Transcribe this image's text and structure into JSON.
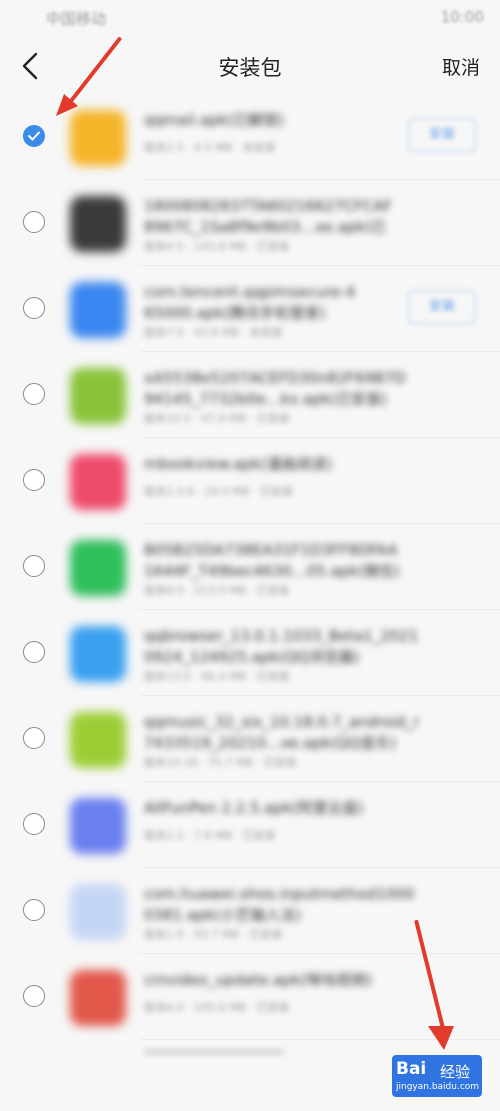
{
  "status_bar": {
    "carrier": "中国移动",
    "time": "10:00"
  },
  "header": {
    "title": "安装包",
    "cancel_label": "取消"
  },
  "items": [
    {
      "name": "qqmail.apk(已解锁)",
      "meta": "版本2.5 · 4.5 MB · 未安装",
      "icon_color": "#f5b52a",
      "checked": true,
      "tag": "安装",
      "single": true
    },
    {
      "name": "18008082837TA60216627CFCAF\n8967C_1Sa8f9e9b03…xe.apk(已",
      "meta": "版本4.5 · 143.8 MB · 已安装",
      "icon_color": "#3a3a3a",
      "checked": false,
      "tag": ""
    },
    {
      "name": "com.tencent.qqpimsecure-4\n65000.apk(腾讯手机管家)",
      "meta": "版本7.5 · 43.8 MB · 未安装",
      "icon_color": "#3a86f0",
      "checked": false,
      "tag": "安装"
    },
    {
      "name": "xA5538e5207ACEFD30n82F69B7D\n94145_7732b0e…kx.apk(已安装)",
      "meta": "版本10.5 · 47.9 MB · 已安装",
      "icon_color": "#8ac33a",
      "checked": false,
      "tag": ""
    },
    {
      "name": "mbookview.apk(漫画阅读)",
      "meta": "版本2.3.6 · 24.0 MB · 已安装",
      "icon_color": "#ee4a6a",
      "checked": false,
      "tag": "",
      "single": true
    },
    {
      "name": "B05B25DA738EA31F1D3FF8DFAA\n1644F_T49bec4630…05.apk(微信)",
      "meta": "版本8.0 · 213.0 MB · 已安装",
      "icon_color": "#2fbf5c",
      "checked": false,
      "tag": ""
    },
    {
      "name": "qqbrowser_13.0.1.1033_Beta1_2021\n0924_124925.apk(QQ浏览器)",
      "meta": "版本13.0 · 66.4 MB · 已安装",
      "icon_color": "#3aa0f0",
      "checked": false,
      "tag": ""
    },
    {
      "name": "qqmusic_32_six_10.18.0.7_android_r\n7433519_20210…xe.apk(QQ音乐)",
      "meta": "版本10.18 · 75.7 MB · 已安装",
      "icon_color": "#9ccd34",
      "checked": false,
      "tag": ""
    },
    {
      "name": "AllFunPen 2.2.5.apk(阿里云盘)",
      "meta": "版本2.2 · 7.8 MB · 已安装",
      "icon_color": "#6a7ff0",
      "checked": false,
      "tag": "",
      "single": true
    },
    {
      "name": "com.huawei.ohos.inputmethod1000\n0381.apk(小艺输入法)",
      "meta": "版本1.0 · 93.7 MB · 已安装",
      "icon_color": "#c5d6f5",
      "checked": false,
      "tag": ""
    },
    {
      "name": "cmvideo_update.apk(咪咕视频)",
      "meta": "版本6.0 · 105.6 MB · 已安装",
      "icon_color": "#e2584a",
      "checked": false,
      "tag": "",
      "single": true
    }
  ],
  "watermark": {
    "brand": "Bai",
    "product": "经验",
    "url": "jingyan.baidu.com"
  }
}
